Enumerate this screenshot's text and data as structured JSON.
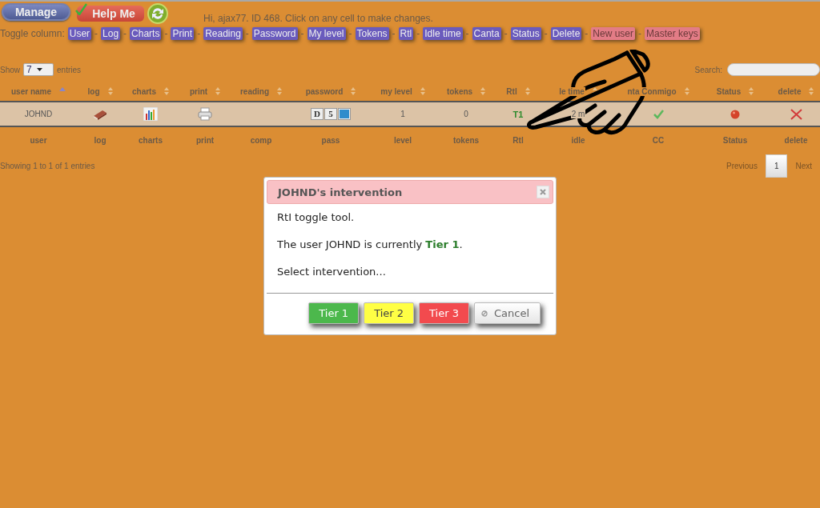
{
  "header": {
    "manage_button": "Manage",
    "help_button": "Help Me",
    "greeting": "Hi, ajax77. ID 468. Click on any cell to make changes."
  },
  "toggle_columns": {
    "label": "Toggle column:",
    "items": [
      {
        "label": "User",
        "kind": "column"
      },
      {
        "separator": "-",
        "label": "Log",
        "kind": "column"
      },
      {
        "separator": "-",
        "label": "Charts",
        "kind": "column"
      },
      {
        "separator": "-",
        "label": "Print",
        "kind": "column"
      },
      {
        "separator": "-",
        "label": "Reading",
        "kind": "column"
      },
      {
        "separator": "-",
        "label": "Password",
        "kind": "column"
      },
      {
        "separator": "-",
        "label": "My level",
        "kind": "column"
      },
      {
        "separator": "-",
        "label": "Tokens",
        "kind": "column"
      },
      {
        "separator": "-",
        "label": "Rtl",
        "kind": "column"
      },
      {
        "separator": "-",
        "label": "Idle time",
        "kind": "column"
      },
      {
        "separator": "-",
        "label": "Canta",
        "kind": "column"
      },
      {
        "separator": "-",
        "label": "Status",
        "kind": "column"
      },
      {
        "separator": "-",
        "label": "Delete",
        "kind": "column"
      },
      {
        "separator": "-",
        "label": "New user",
        "kind": "action"
      },
      {
        "separator": "-",
        "label": "Master keys",
        "kind": "action"
      }
    ]
  },
  "table": {
    "show_label": "Show",
    "page_size": "7",
    "entries_label": "entries",
    "search_label": "Search:",
    "columns": [
      {
        "label": "user name",
        "sorted": true
      },
      {
        "label": "log",
        "sorted": false
      },
      {
        "label": "charts",
        "sorted": false
      },
      {
        "label": "print",
        "sorted": false
      },
      {
        "label": "reading",
        "sorted": false
      },
      {
        "label": "password",
        "sorted": false
      },
      {
        "label": "my level",
        "sorted": false
      },
      {
        "label": "tokens",
        "sorted": false
      },
      {
        "label": "Rtl",
        "sorted": false
      },
      {
        "label": "le time",
        "sorted": false
      },
      {
        "label": "nta Conmigo",
        "sorted": false
      },
      {
        "label": "Status",
        "sorted": false
      },
      {
        "label": "delete",
        "sorted": false
      }
    ],
    "rows": [
      {
        "cells": [
          {
            "kind": "text",
            "text": "JOHND"
          },
          {
            "kind": "log"
          },
          {
            "kind": "chart"
          },
          {
            "kind": "print"
          },
          {
            "kind": "empty"
          },
          {
            "kind": "password",
            "letters": [
              "D",
              "5"
            ]
          },
          {
            "kind": "text",
            "text": "1"
          },
          {
            "kind": "text",
            "text": "0"
          },
          {
            "kind": "tier",
            "text": "T1"
          },
          {
            "kind": "text",
            "text": "2 m"
          },
          {
            "kind": "check"
          },
          {
            "kind": "status"
          },
          {
            "kind": "delete"
          }
        ]
      }
    ],
    "footer": [
      "user",
      "log",
      "charts",
      "print",
      "comp",
      "pass",
      "level",
      "tokens",
      "Rtl",
      "idle",
      "CC",
      "Status",
      "delete"
    ],
    "info": "Showing 1 to 1 of 1 entries",
    "pagination": [
      {
        "label": "Previous",
        "disabled": true,
        "selected": false
      },
      {
        "label": "1",
        "disabled": false,
        "selected": true
      },
      {
        "label": "Next",
        "disabled": true,
        "selected": false
      }
    ]
  },
  "dialog": {
    "title": "JOHND's intervention",
    "paragraphs": [
      "RtI toggle tool.",
      "The user JOHND is currently **Tier 1**.",
      "Select intervention..."
    ],
    "buttons": [
      {
        "label": "Tier 1",
        "kind": "tier",
        "color": "#4cb84c"
      },
      {
        "label": "Tier 2",
        "kind": "tier",
        "color": "#ffff44"
      },
      {
        "label": "Tier 3",
        "kind": "tier",
        "color": "#f24a4e"
      },
      {
        "label": "Cancel",
        "kind": "cancel"
      }
    ]
  }
}
